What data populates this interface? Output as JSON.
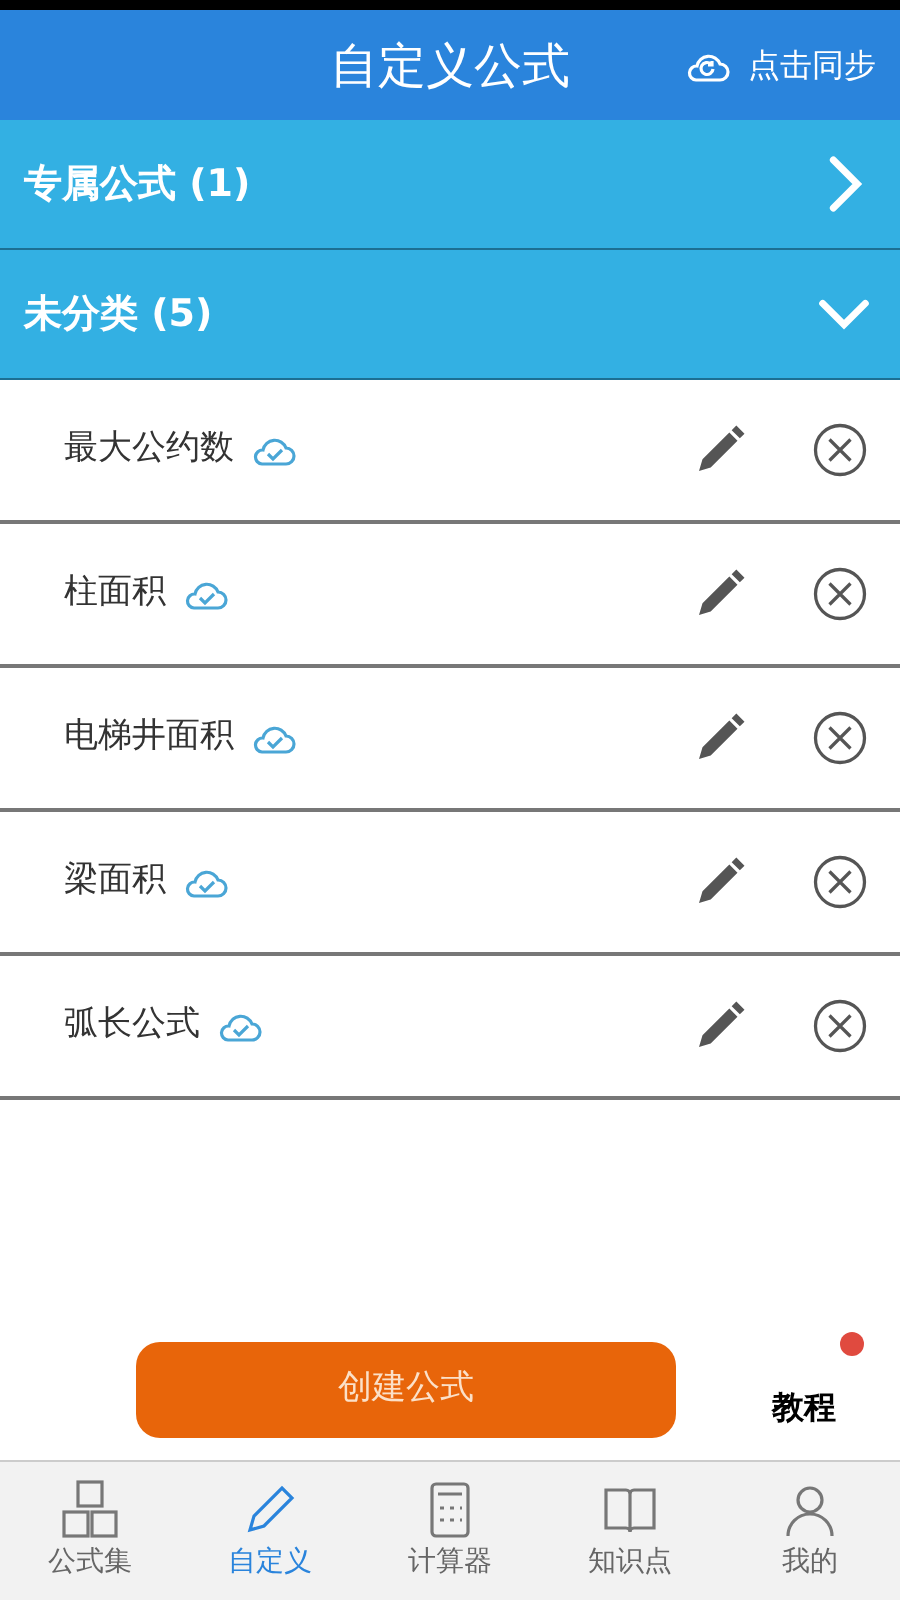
{
  "header": {
    "title": "自定义公式",
    "sync_label": "点击同步"
  },
  "groups": [
    {
      "label": "专属公式 (1)",
      "expanded": false
    },
    {
      "label": "未分类 (5)",
      "expanded": true,
      "items": [
        {
          "name": "最大公约数"
        },
        {
          "name": "柱面积"
        },
        {
          "name": "电梯井面积"
        },
        {
          "name": "梁面积"
        },
        {
          "name": "弧长公式"
        }
      ]
    }
  ],
  "create_button": "创建公式",
  "tutorial": {
    "label": "教程",
    "unread": true
  },
  "tabs": [
    {
      "label": "公式集",
      "selected": false
    },
    {
      "label": "自定义",
      "selected": true
    },
    {
      "label": "计算器",
      "selected": false
    },
    {
      "label": "知识点",
      "selected": false
    },
    {
      "label": "我的",
      "selected": false
    }
  ]
}
